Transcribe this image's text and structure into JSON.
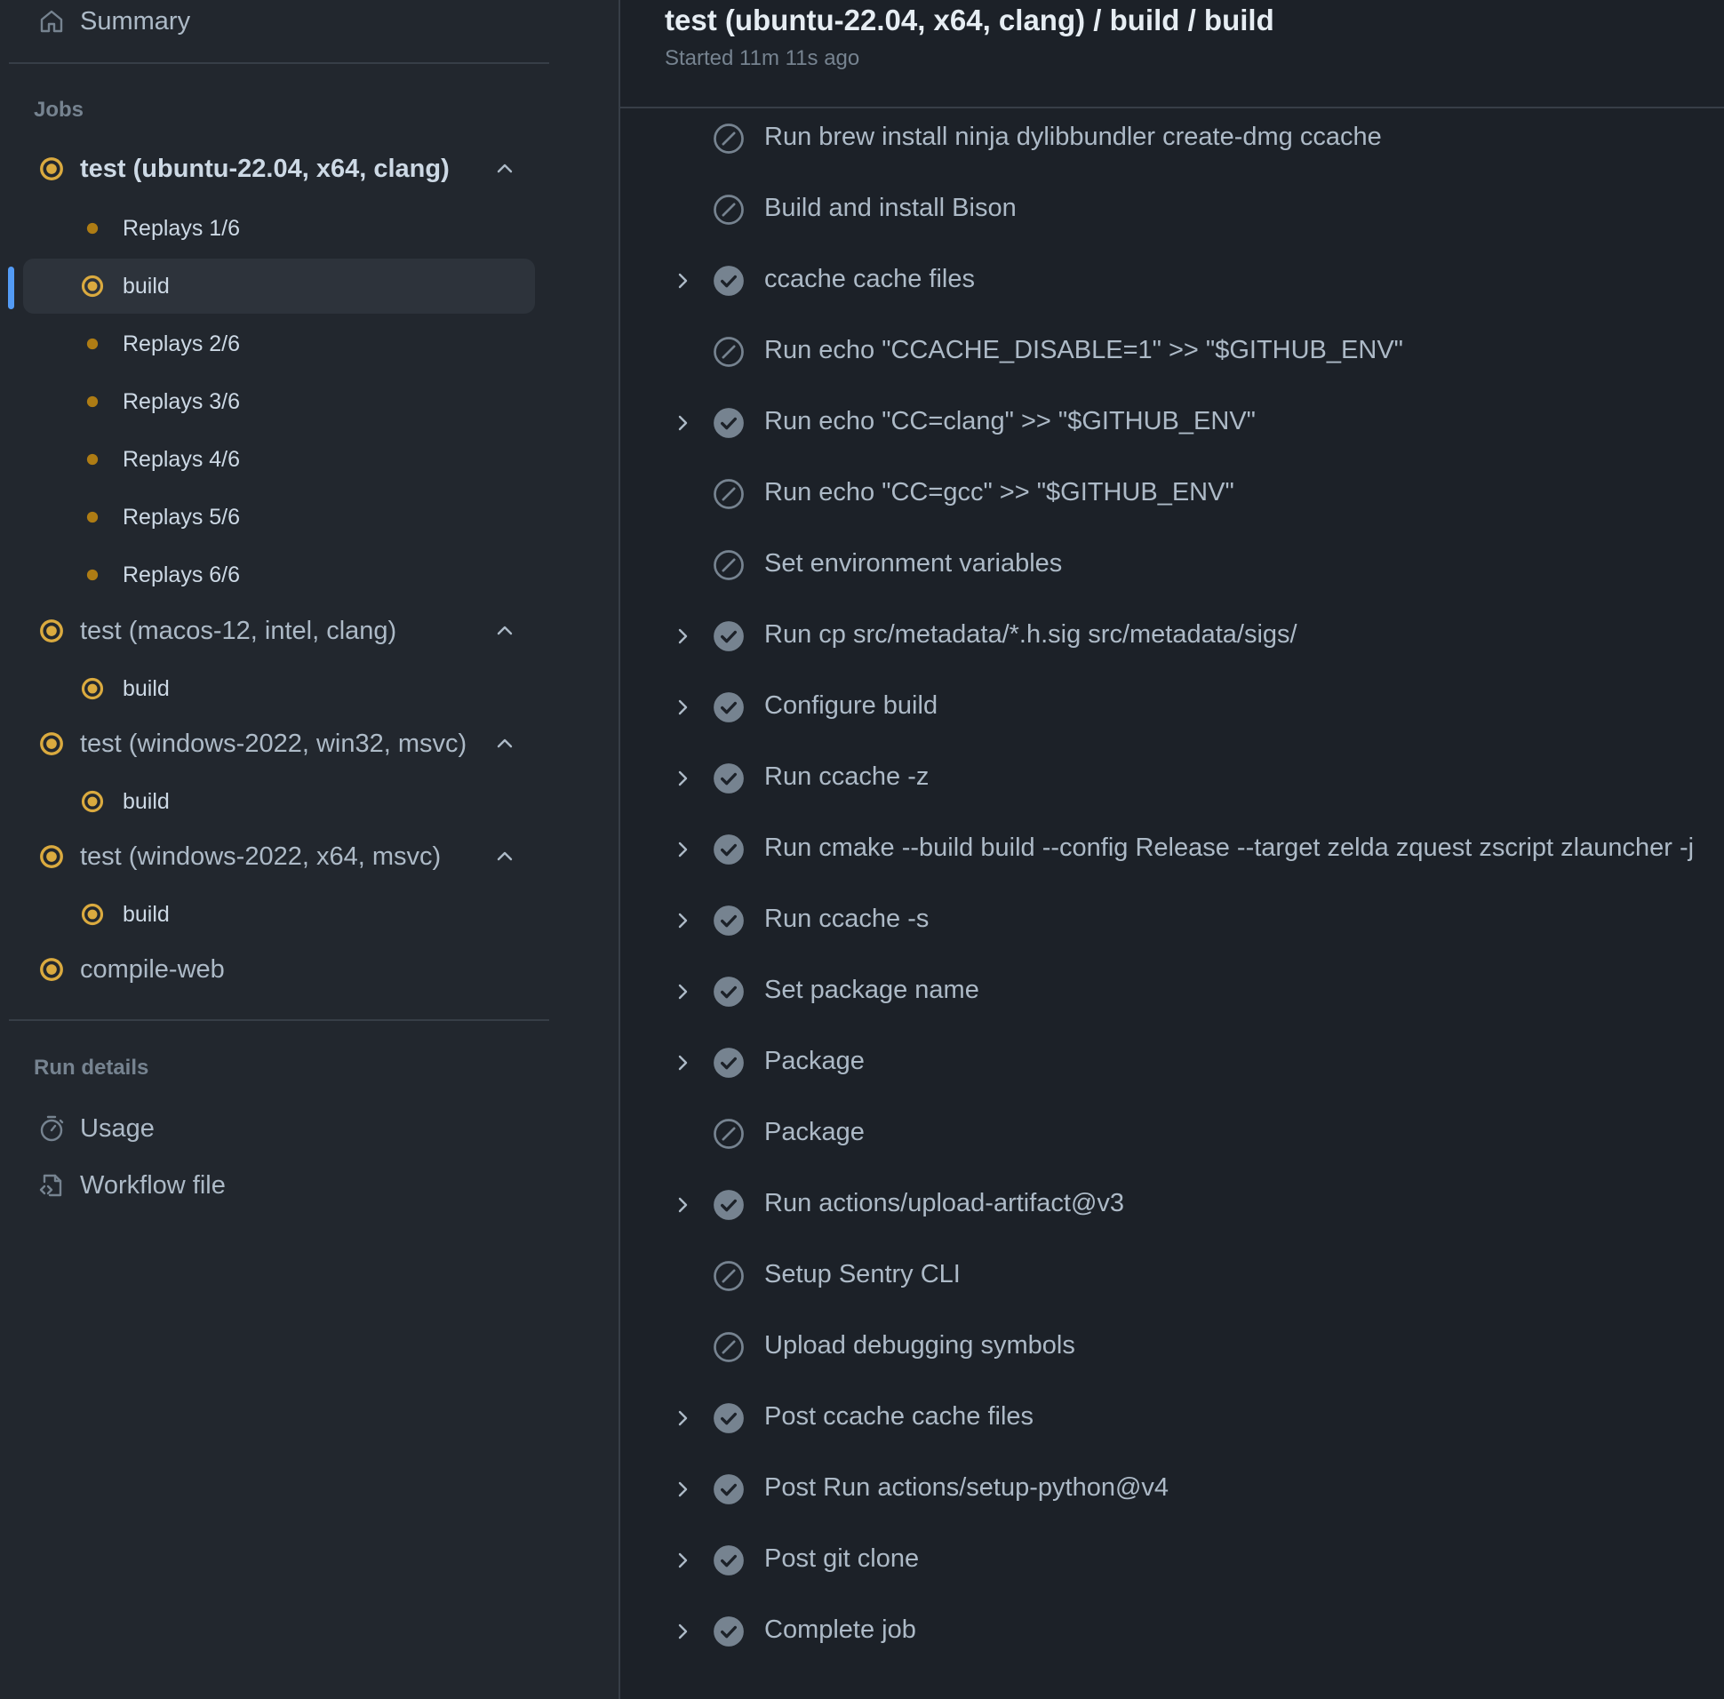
{
  "sidebar": {
    "summary_label": "Summary",
    "jobs_heading": "Jobs",
    "jobs": [
      {
        "label": "test (ubuntu-22.04, x64, clang)",
        "status": "in-progress",
        "expanded": true,
        "steps": [
          {
            "label": "Replays 1/6",
            "status": "queued"
          },
          {
            "label": "build",
            "status": "in-progress",
            "active": true
          },
          {
            "label": "Replays 2/6",
            "status": "queued"
          },
          {
            "label": "Replays 3/6",
            "status": "queued"
          },
          {
            "label": "Replays 4/6",
            "status": "queued"
          },
          {
            "label": "Replays 5/6",
            "status": "queued"
          },
          {
            "label": "Replays 6/6",
            "status": "queued"
          }
        ]
      },
      {
        "label": "test (macos-12, intel, clang)",
        "status": "in-progress",
        "expanded": true,
        "steps": [
          {
            "label": "build",
            "status": "in-progress"
          }
        ]
      },
      {
        "label": "test (windows-2022, win32, msvc)",
        "status": "in-progress",
        "expanded": true,
        "steps": [
          {
            "label": "build",
            "status": "in-progress"
          }
        ]
      },
      {
        "label": "test (windows-2022, x64, msvc)",
        "status": "in-progress",
        "expanded": true,
        "steps": [
          {
            "label": "build",
            "status": "in-progress"
          }
        ]
      },
      {
        "label": "compile-web",
        "status": "in-progress"
      }
    ],
    "run_details_heading": "Run details",
    "usage_label": "Usage",
    "workflow_file_label": "Workflow file"
  },
  "main": {
    "title": "test (ubuntu-22.04, x64, clang) / build / build",
    "subtitle": "Started 11m 11s ago",
    "steps": [
      {
        "label": "Run brew install ninja dylibbundler create-dmg ccache",
        "status": "skipped"
      },
      {
        "label": "Build and install Bison",
        "status": "skipped"
      },
      {
        "label": "ccache cache files",
        "status": "success"
      },
      {
        "label": "Run echo \"CCACHE_DISABLE=1\" >> \"$GITHUB_ENV\"",
        "status": "skipped"
      },
      {
        "label": "Run echo \"CC=clang\" >> \"$GITHUB_ENV\"",
        "status": "success"
      },
      {
        "label": "Run echo \"CC=gcc\" >> \"$GITHUB_ENV\"",
        "status": "skipped"
      },
      {
        "label": "Set environment variables",
        "status": "skipped"
      },
      {
        "label": "Run cp src/metadata/*.h.sig src/metadata/sigs/",
        "status": "success"
      },
      {
        "label": "Configure build",
        "status": "success"
      },
      {
        "label": "Run ccache -z",
        "status": "success"
      },
      {
        "label": "Run cmake --build build --config Release --target zelda zquest zscript zlauncher -j",
        "status": "success"
      },
      {
        "label": "Run ccache -s",
        "status": "success"
      },
      {
        "label": "Set package name",
        "status": "success"
      },
      {
        "label": "Package",
        "status": "success"
      },
      {
        "label": "Package",
        "status": "skipped"
      },
      {
        "label": "Run actions/upload-artifact@v3",
        "status": "success"
      },
      {
        "label": "Setup Sentry CLI",
        "status": "skipped"
      },
      {
        "label": "Upload debugging symbols",
        "status": "skipped"
      },
      {
        "label": "Post ccache cache files",
        "status": "success"
      },
      {
        "label": "Post Run actions/setup-python@v4",
        "status": "success"
      },
      {
        "label": "Post git clone",
        "status": "success"
      },
      {
        "label": "Complete job",
        "status": "success"
      }
    ]
  },
  "colors": {
    "in_progress": "#daaa3f",
    "queued": "#ae7c14",
    "success_icon": "#768390",
    "skipped_icon": "#768390",
    "accent": "#539bf5"
  }
}
